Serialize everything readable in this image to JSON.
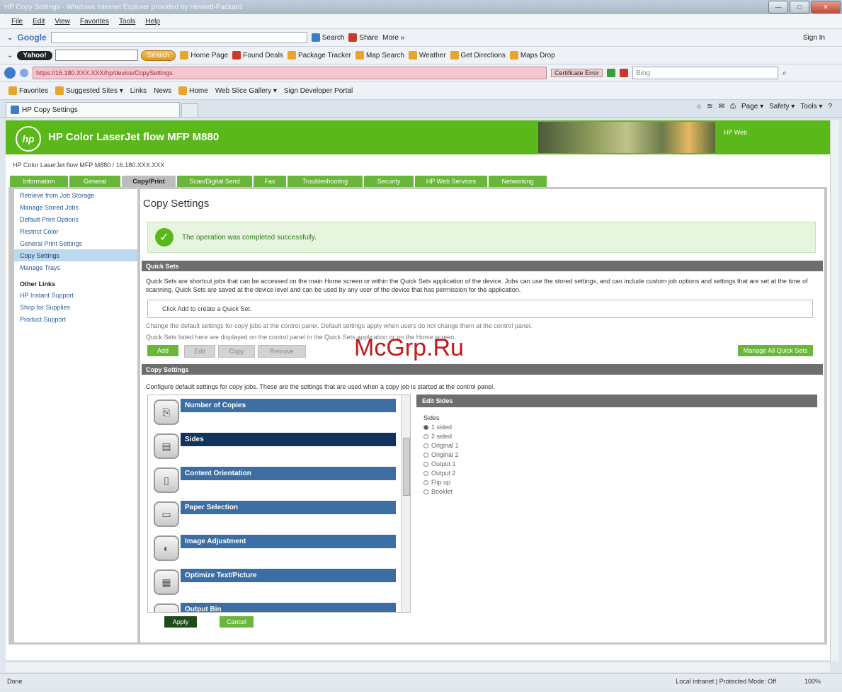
{
  "window": {
    "title": "HP Copy Settings - Windows Internet Explorer provided by Hewlett-Packard"
  },
  "menu": [
    "File",
    "Edit",
    "View",
    "Favorites",
    "Tools",
    "Help"
  ],
  "google_bar": {
    "logo": "Google",
    "search_btn": "Search",
    "share": "Share",
    "more": "More »",
    "signin": "Sign In"
  },
  "yahoo_bar": {
    "brand": "Yahoo!",
    "search_btn": "Search",
    "items": [
      "Home Page",
      "Found Deals",
      "Package Tracker",
      "Map Search",
      "Weather",
      "Get Directions",
      "Maps Drop"
    ]
  },
  "address": {
    "url": "https://16.180.XXX.XXX/hp/device/CopySettings",
    "cert": "Certificate Error",
    "search_placeholder": "Bing"
  },
  "favorites": {
    "label": "Favorites",
    "items": [
      "Suggested Sites ▾",
      "Links",
      "News",
      "Home",
      "Web Slice Gallery ▾",
      "Sign Developer Portal"
    ]
  },
  "browser_tab": {
    "label": "HP Copy Settings"
  },
  "commands": [
    "Page ▾",
    "Safety ▾",
    "Tools ▾"
  ],
  "hp": {
    "title": "HP Color LaserJet flow MFP M880",
    "right_text": "HP Web",
    "breadcrumb": "HP Color LaserJet flow MFP M880 / 16.180.XXX.XXX",
    "tabs": [
      "Information",
      "General",
      "Copy/Print",
      "Scan/Digital Send",
      "Fax",
      "Troubleshooting",
      "Security",
      "HP Web Services",
      "Networking"
    ],
    "active_tab": "Copy/Print"
  },
  "leftnav": {
    "items": [
      "Retrieve from Job Storage",
      "Manage Stored Jobs",
      "Default Print Options",
      "Restrict Color",
      "General Print Settings",
      "Copy Settings",
      "Manage Trays"
    ],
    "selected": "Copy Settings",
    "other_links_title": "Other Links",
    "other_links": [
      "HP Instant Support",
      "Shop for Supplies",
      "Product Support"
    ]
  },
  "main": {
    "heading": "Copy Settings",
    "success": "The operation was completed successfully.",
    "quick_sets_title": "Quick Sets",
    "quick_sets_desc": "Quick Sets are shortcut jobs that can be accessed on the main Home screen or within the Quick Sets application of the device. Jobs can use the stored settings, and can include custom job options and settings that are set at the time of scanning. Quick Sets are saved at the device level and can be used by any user of the device that has permission for the application.",
    "quick_sets_empty": "Click Add to create a Quick Set.",
    "hint1": "Change the default settings for copy jobs at the control panel. Default settings apply when users do not change them at the control panel.",
    "hint2": "Quick Sets listed here are displayed on the control panel in the Quick Sets application or on the Home screen.",
    "buttons": {
      "add": "Add",
      "edit": "Edit",
      "copy": "Copy",
      "remove": "Remove",
      "manage": "Manage All Quick Sets"
    },
    "copy_settings_title": "Copy Settings",
    "copy_settings_desc": "Configure default settings for copy jobs. These are the settings that are used when a copy job is started at the control panel.",
    "options": [
      {
        "label": "Number of Copies",
        "icon": "copies-icon",
        "glyph": "⎘"
      },
      {
        "label": "Sides",
        "icon": "sides-icon",
        "glyph": "▤"
      },
      {
        "label": "Content Orientation",
        "icon": "orientation-icon",
        "glyph": "▯"
      },
      {
        "label": "Paper Selection",
        "icon": "paper-icon",
        "glyph": "▭"
      },
      {
        "label": "Image Adjustment",
        "icon": "image-adjust-icon",
        "glyph": "◐"
      },
      {
        "label": "Optimize Text/Picture",
        "icon": "optimize-icon",
        "glyph": "▦"
      },
      {
        "label": "Output Bin",
        "icon": "output-bin-icon",
        "glyph": "▥"
      }
    ],
    "selected_option": "Sides",
    "panel": {
      "title": "Edit Sides",
      "section": "Sides",
      "choices": [
        "1 sided",
        "2 sided",
        "Original 1",
        "Original 2",
        "Output 1",
        "Output 2",
        "Flip up",
        "Booklet"
      ],
      "selected_choice": "1 sided"
    },
    "apply": "Apply",
    "cancel": "Cancel"
  },
  "watermark": "McGrp.Ru",
  "statusbar": {
    "left": "Done",
    "zone": "Local intranet | Protected Mode: Off",
    "zoom": "100%"
  }
}
